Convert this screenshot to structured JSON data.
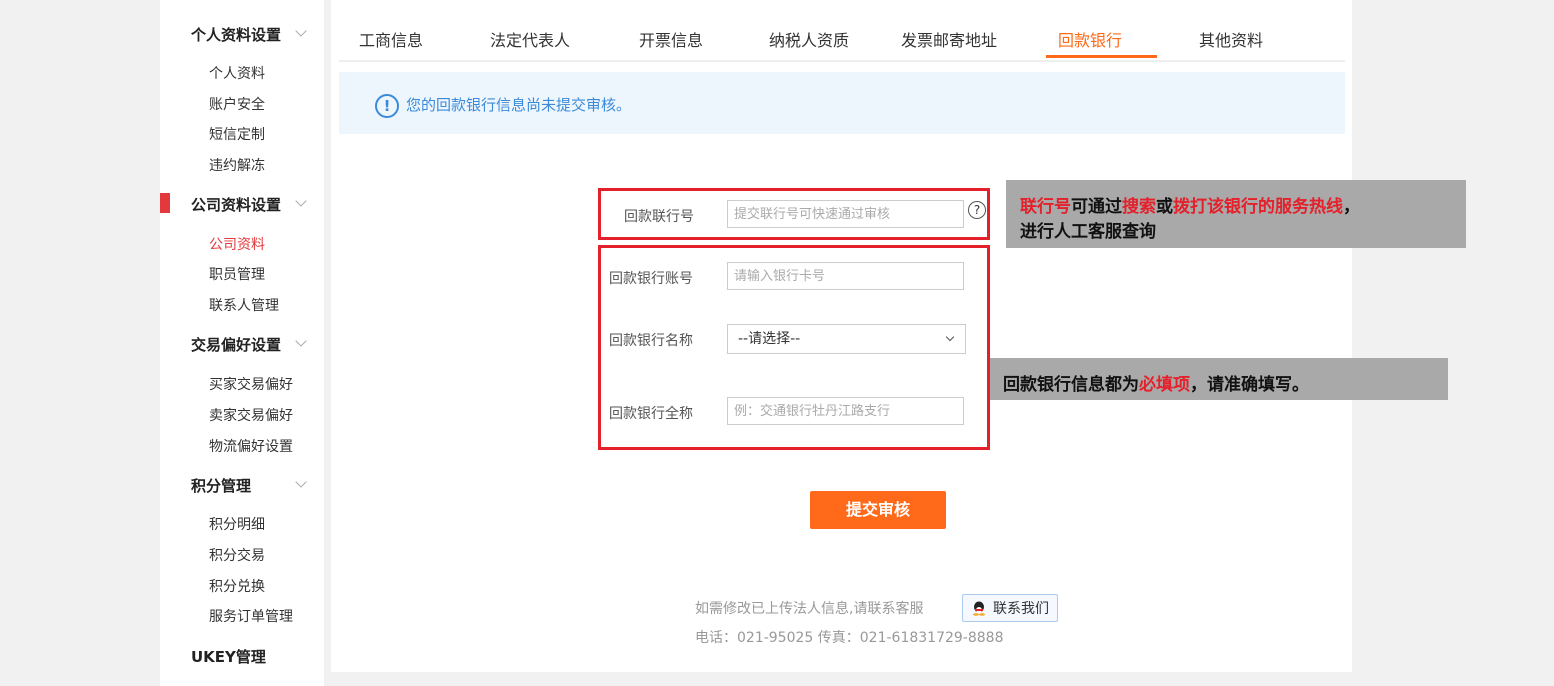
{
  "sidebar": {
    "sections": [
      {
        "title": "个人资料设置",
        "items": [
          "个人资料",
          "账户安全",
          "短信定制",
          "违约解冻"
        ]
      },
      {
        "title": "公司资料设置",
        "items": [
          "公司资料",
          "职员管理",
          "联系人管理"
        ]
      },
      {
        "title": "交易偏好设置",
        "items": [
          "买家交易偏好",
          "卖家交易偏好",
          "物流偏好设置"
        ]
      },
      {
        "title": "积分管理",
        "items": [
          "积分明细",
          "积分交易",
          "积分兑换",
          "服务订单管理"
        ]
      },
      {
        "title": "UKEY管理",
        "items": []
      }
    ],
    "active_item": "公司资料"
  },
  "tabs": [
    "工商信息",
    "法定代表人",
    "开票信息",
    "纳税人资质",
    "发票邮寄地址",
    "回款银行",
    "其他资料"
  ],
  "active_tab": "回款银行",
  "notice": {
    "icon": "exclamation-circle-icon",
    "text": "您的回款银行信息尚未提交审核。"
  },
  "form": {
    "bank_code": {
      "label": "回款联行号",
      "placeholder": "提交联行号可快速通过审核",
      "help": "?"
    },
    "account": {
      "label": "回款银行账号",
      "placeholder": "请输入银行卡号"
    },
    "bank_name": {
      "label": "回款银行名称",
      "selected": "--请选择--"
    },
    "full_name": {
      "label": "回款银行全称",
      "placeholder": "例：交通银行牡丹江路支行"
    },
    "submit_label": "提交审核"
  },
  "footer": {
    "note": "如需修改已上传法人信息,请联系客服",
    "contact_label": "联系我们",
    "phone": "电话：021-95025 传真：021-61831729-8888"
  },
  "annotations": {
    "callout1": {
      "p1": "联行号",
      "p2": "可通过",
      "p3": "搜索",
      "p4": "或",
      "p5": "拨打该银行的服务热线",
      "p6": "，",
      "line2": "进行人工客服查询"
    },
    "callout2": {
      "p1": "回款银行信息都为",
      "p2": "必填项",
      "p3": "，请准确填写。"
    }
  },
  "colors": {
    "accent": "#ff6a1a",
    "highlight": "#e4202b",
    "info": "#3b8ad9"
  }
}
